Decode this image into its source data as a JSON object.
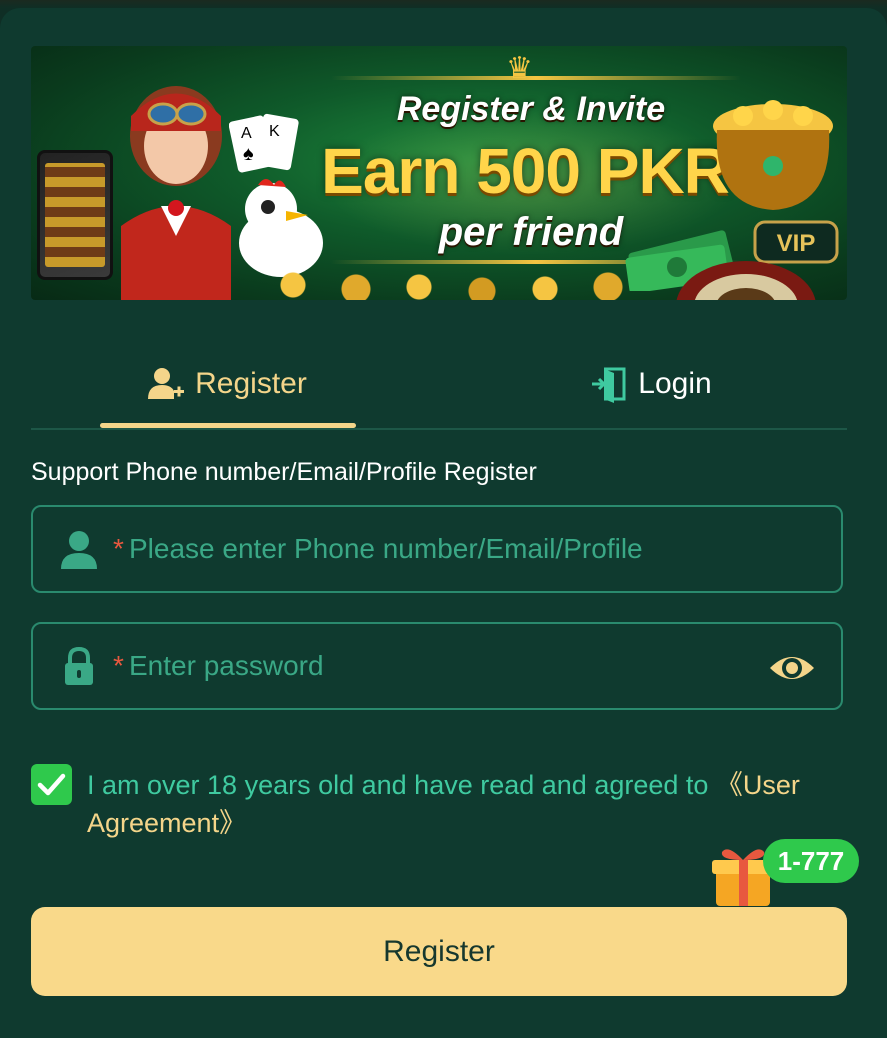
{
  "banner": {
    "line1": "Register & Invite",
    "line2": "Earn 500 PKR",
    "line3": "per friend",
    "vip_text": "VIP"
  },
  "tabs": [
    {
      "label": "Register",
      "icon": "add-user-icon",
      "active": true
    },
    {
      "label": "Login",
      "icon": "login-door-icon",
      "active": false
    }
  ],
  "form": {
    "hint": "Support Phone number/Email/Profile Register",
    "account": {
      "required_mark": "*",
      "placeholder": "Please enter Phone number/Email/Profile",
      "value": "",
      "icon": "user-icon"
    },
    "password": {
      "required_mark": "*",
      "placeholder": "Enter password",
      "value": "",
      "icon": "lock-icon",
      "toggle_icon": "eye-icon"
    },
    "agreement": {
      "checked": true,
      "text": "I am over 18 years old and have read and agreed to ",
      "link": "《User Agreement》"
    },
    "submit_label": "Register"
  },
  "gift_badge": "1-777",
  "colors": {
    "background": "#0f3a2f",
    "accent": "#f4d58a",
    "field_border": "#2a8a6e",
    "placeholder": "#3aa886",
    "checkbox": "#2fc94c",
    "required": "#e8583f",
    "button": "#f9d98a"
  }
}
